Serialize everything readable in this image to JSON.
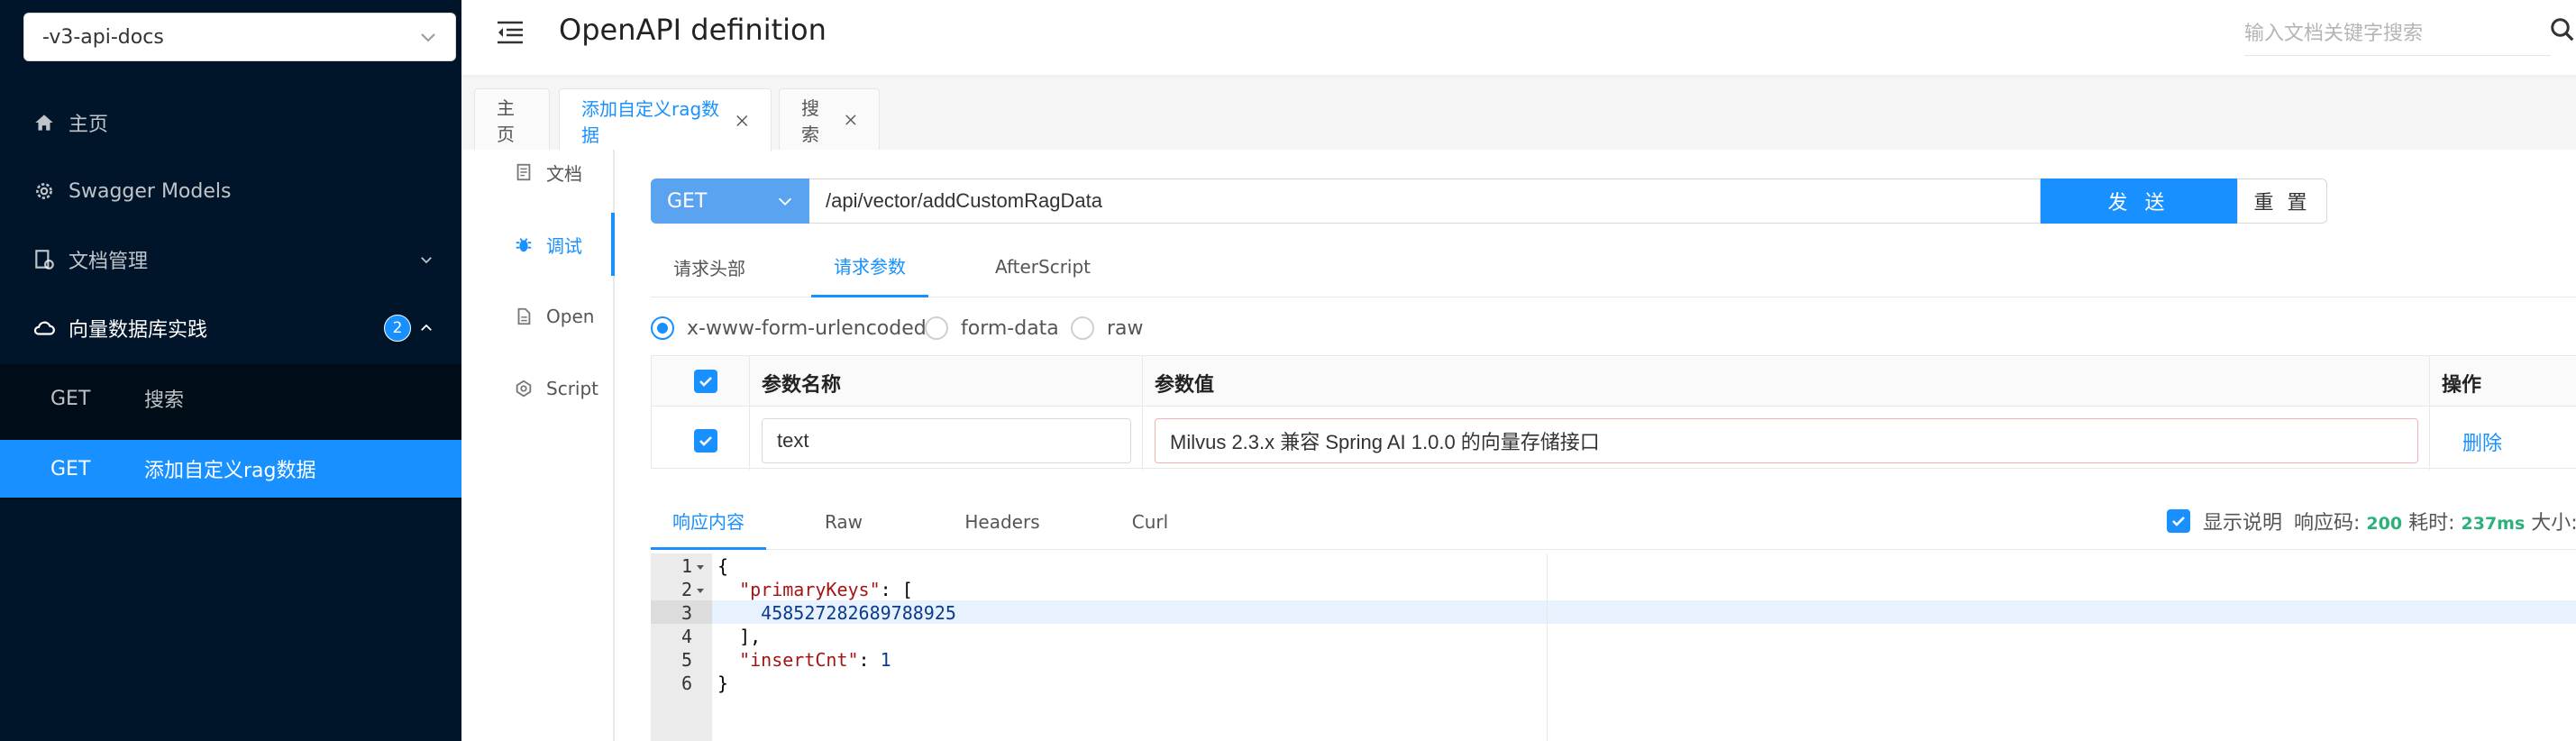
{
  "sidebar": {
    "group_select": "-v3-api-docs",
    "items": [
      {
        "label": "主页",
        "icon": "home-icon"
      },
      {
        "label": "Swagger Models",
        "icon": "gear-icon"
      },
      {
        "label": "文档管理",
        "icon": "doc-manage-icon"
      },
      {
        "label": "向量数据库实践",
        "icon": "cloud-icon",
        "badge": "2"
      }
    ],
    "sub_items": [
      {
        "method": "GET",
        "label": "搜索"
      },
      {
        "method": "GET",
        "label": "添加自定义rag数据"
      }
    ]
  },
  "header": {
    "title": "OpenAPI definition",
    "search_placeholder": "输入文档关键字搜索"
  },
  "tabs": [
    {
      "label": "主页"
    },
    {
      "label": "添加自定义rag数据"
    },
    {
      "label": "搜索"
    }
  ],
  "vnav": [
    {
      "label": "文档",
      "icon": "document-icon"
    },
    {
      "label": "调试",
      "icon": "bug-icon"
    },
    {
      "label": "Open",
      "icon": "file-icon"
    },
    {
      "label": "Script",
      "icon": "code-icon"
    }
  ],
  "request": {
    "method": "GET",
    "url": "/api/vector/addCustomRagData",
    "send_label": "发 送",
    "reset_label": "重 置"
  },
  "sub_tabs": [
    {
      "label": "请求头部"
    },
    {
      "label": "请求参数"
    },
    {
      "label": "AfterScript"
    }
  ],
  "body_types": [
    {
      "label": "x-www-form-urlencoded",
      "selected": true
    },
    {
      "label": "form-data",
      "selected": false
    },
    {
      "label": "raw",
      "selected": false
    }
  ],
  "params": {
    "headers": {
      "name": "参数名称",
      "value": "参数值",
      "action": "操作"
    },
    "rows": [
      {
        "checked": true,
        "name": "text",
        "value": "Milvus 2.3.x 兼容 Spring AI 1.0.0 的向量存储接口",
        "action": "删除"
      }
    ]
  },
  "response": {
    "tabs": [
      {
        "label": "响应内容"
      },
      {
        "label": "Raw"
      },
      {
        "label": "Headers"
      },
      {
        "label": "Curl"
      }
    ],
    "show_desc_label": "显示说明",
    "show_desc_checked": true,
    "code_label": "响应码:",
    "code_value": "200",
    "time_label": "耗时:",
    "time_value": "237ms",
    "size_label": "大小:",
    "line_numbers": [
      "1",
      "2",
      "3",
      "4",
      "5",
      "6"
    ],
    "lines": {
      "l1": "{",
      "l2_key": "\"primaryKeys\"",
      "l2_rest": ": [",
      "l3": "458527282689788925",
      "l4": "],",
      "l5_key": "\"insertCnt\"",
      "l5_sep": ": ",
      "l5_val": "1",
      "l6": "}"
    }
  },
  "colors": {
    "sidebar_bg": "#001529",
    "accent": "#1890ff",
    "method_bg": "#5aa3f0",
    "success": "#2bb27a"
  }
}
